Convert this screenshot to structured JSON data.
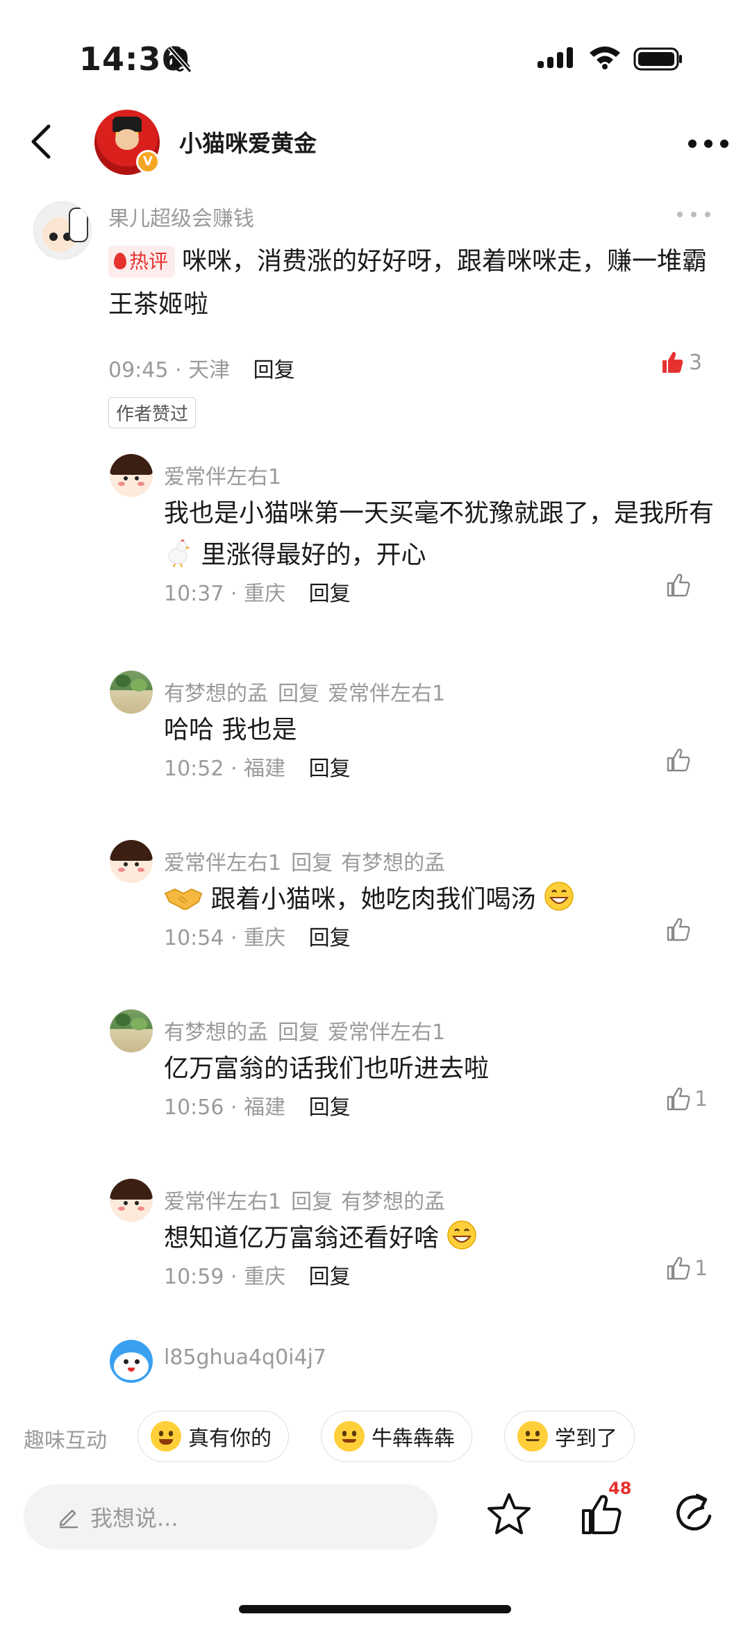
{
  "status_bar": {
    "time": "14:36"
  },
  "header": {
    "account_name": "小猫咪爱黄金"
  },
  "main_comment": {
    "author": "果儿超级会赚钱",
    "hot_tag": "热评",
    "text": "咪咪，消费涨的好好呀，跟着咪咪走，赚一堆霸王茶姬啦",
    "time": "09:45",
    "location": "天津",
    "reply_label": "回复",
    "like_count": "3",
    "author_liked_badge": "作者赞过"
  },
  "replies": [
    {
      "author": "爱常伴左右1",
      "reply_to": "",
      "text_a": "我也是小猫咪第一天买毫不犹豫就跟了，是我所有",
      "text_b": "里涨得最好的，开心",
      "time": "10:37",
      "location": "重庆",
      "reply_label": "回复",
      "like_count": ""
    },
    {
      "author": "有梦想的孟",
      "connector": "回复",
      "reply_to": "爱常伴左右1",
      "text": "哈哈 我也是",
      "time": "10:52",
      "location": "福建",
      "reply_label": "回复",
      "like_count": ""
    },
    {
      "author": "爱常伴左右1",
      "connector": "回复",
      "reply_to": "有梦想的孟",
      "text": "跟着小猫咪，她吃肉我们喝汤",
      "time": "10:54",
      "location": "重庆",
      "reply_label": "回复",
      "like_count": ""
    },
    {
      "author": "有梦想的孟",
      "connector": "回复",
      "reply_to": "爱常伴左右1",
      "text": "亿万富翁的话我们也听进去啦",
      "time": "10:56",
      "location": "福建",
      "reply_label": "回复",
      "like_count": "1"
    },
    {
      "author": "爱常伴左右1",
      "connector": "回复",
      "reply_to": "有梦想的孟",
      "text": "想知道亿万富翁还看好啥",
      "time": "10:59",
      "location": "重庆",
      "reply_label": "回复",
      "like_count": "1"
    }
  ],
  "next_user": {
    "author": "l85ghua4q0i4j7"
  },
  "fun_interaction": {
    "label": "趣味互动",
    "chips": [
      "真有你的",
      "牛犇犇犇",
      "学到了"
    ]
  },
  "bottom_bar": {
    "input_placeholder": "我想说...",
    "like_count": "48"
  },
  "colors": {
    "accent_red": "#e5322f",
    "muted_text": "#9a9a9a"
  },
  "icons": [
    "back-icon",
    "more-icon",
    "bell-off-icon",
    "signal-icon",
    "wifi-icon",
    "battery-icon",
    "thumbs-up-icon",
    "star-icon",
    "share-icon",
    "pencil-icon",
    "rooster-emoji",
    "handshake-emoji",
    "grin-emoji"
  ]
}
